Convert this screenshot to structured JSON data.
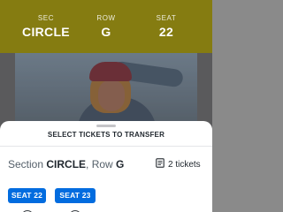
{
  "ticket": {
    "sec_label": "SEC",
    "sec_value": "CIRCLE",
    "row_label": "ROW",
    "row_value": "G",
    "seat_label": "SEAT",
    "seat_value": "22"
  },
  "sheet": {
    "title": "SELECT TICKETS TO TRANSFER",
    "section_prefix": "Section ",
    "section_value": "CIRCLE",
    "row_prefix": ", Row ",
    "row_value": "G",
    "tickets_count": "2 tickets",
    "ticket_icon": "ticket-icon",
    "seats": [
      {
        "label": "SEAT 22",
        "icon": "checkbox-circle-icon"
      },
      {
        "label": "SEAT 23",
        "icon": "checkbox-circle-icon"
      }
    ]
  },
  "colors": {
    "ticket_header": "#f1e11f",
    "seat_button": "#026cdf",
    "sheet_background": "#ffffff"
  }
}
